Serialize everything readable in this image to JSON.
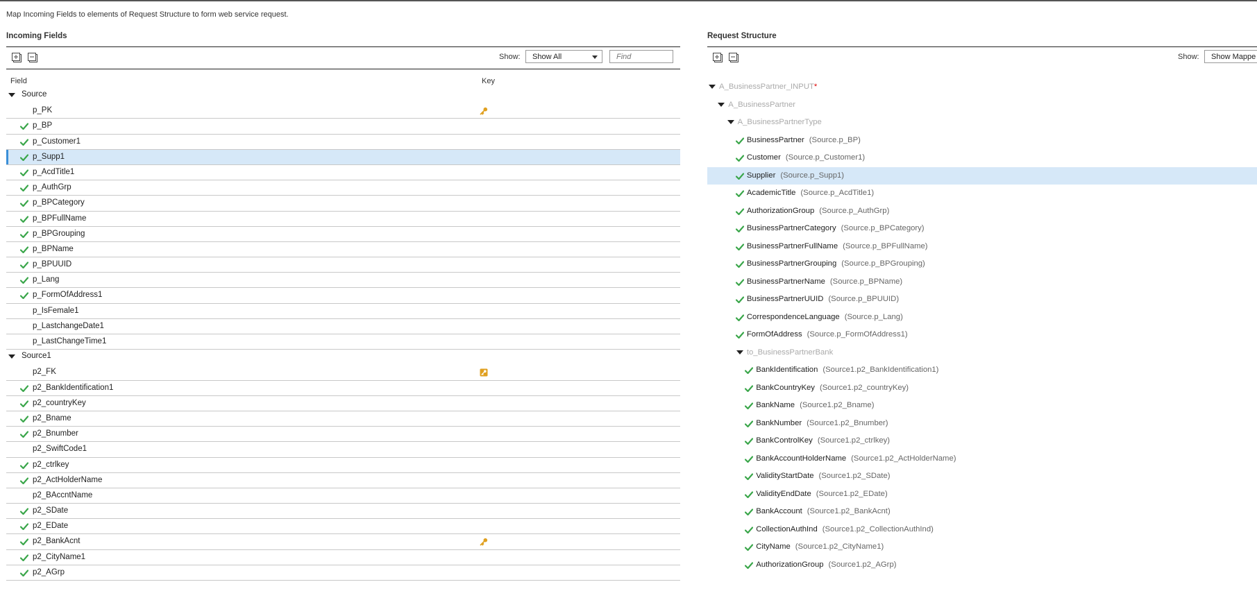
{
  "instruction": "Map Incoming Fields to elements of Request Structure to form web service request.",
  "incoming": {
    "title": "Incoming Fields",
    "show_label": "Show:",
    "show_value": "Show All",
    "find_placeholder": "Find",
    "col_field": "Field",
    "col_key": "Key",
    "rows": [
      {
        "name": "Source",
        "group": true
      },
      {
        "name": "p_PK",
        "mapped": false,
        "key": "key"
      },
      {
        "name": "p_BP",
        "mapped": true
      },
      {
        "name": "p_Customer1",
        "mapped": true
      },
      {
        "name": "p_Supp1",
        "mapped": true,
        "selected": true
      },
      {
        "name": "p_AcdTitle1",
        "mapped": true
      },
      {
        "name": "p_AuthGrp",
        "mapped": true
      },
      {
        "name": "p_BPCategory",
        "mapped": true
      },
      {
        "name": "p_BPFullName",
        "mapped": true
      },
      {
        "name": "p_BPGrouping",
        "mapped": true
      },
      {
        "name": "p_BPName",
        "mapped": true
      },
      {
        "name": "p_BPUUID",
        "mapped": true
      },
      {
        "name": "p_Lang",
        "mapped": true
      },
      {
        "name": "p_FormOfAddress1",
        "mapped": true
      },
      {
        "name": "p_IsFemale1",
        "mapped": false
      },
      {
        "name": "p_LastchangeDate1",
        "mapped": false
      },
      {
        "name": "p_LastChangeTime1",
        "mapped": false
      },
      {
        "name": "Source1",
        "group": true
      },
      {
        "name": "p2_FK",
        "mapped": false,
        "key": "foreign-key"
      },
      {
        "name": "p2_BankIdentification1",
        "mapped": true
      },
      {
        "name": "p2_countryKey",
        "mapped": true
      },
      {
        "name": "p2_Bname",
        "mapped": true
      },
      {
        "name": "p2_Bnumber",
        "mapped": true
      },
      {
        "name": "p2_SwiftCode1",
        "mapped": false
      },
      {
        "name": "p2_ctrlkey",
        "mapped": true
      },
      {
        "name": "p2_ActHolderName",
        "mapped": true
      },
      {
        "name": "p2_BAccntName",
        "mapped": false
      },
      {
        "name": "p2_SDate",
        "mapped": true
      },
      {
        "name": "p2_EDate",
        "mapped": true
      },
      {
        "name": "p2_BankAcnt",
        "mapped": true,
        "key": "key"
      },
      {
        "name": "p2_CityName1",
        "mapped": true
      },
      {
        "name": "p2_AGrp",
        "mapped": true
      }
    ]
  },
  "request": {
    "title": "Request Structure",
    "show_label": "Show:",
    "show_value": "Show Mappe",
    "nodes": [
      {
        "name": "A_BusinessPartner_INPUT",
        "level": 0,
        "expand": true,
        "dim": true,
        "required": "*"
      },
      {
        "name": "A_BusinessPartner",
        "level": 1,
        "expand": true,
        "dim": true
      },
      {
        "name": "A_BusinessPartnerType",
        "level": 2,
        "expand": true,
        "dim": true
      },
      {
        "name": "BusinessPartner",
        "level": 3,
        "mapped": true,
        "src": "(Source.p_BP)"
      },
      {
        "name": "Customer",
        "level": 3,
        "mapped": true,
        "src": "(Source.p_Customer1)"
      },
      {
        "name": "Supplier",
        "level": 3,
        "mapped": true,
        "src": "(Source.p_Supp1)",
        "selected": true
      },
      {
        "name": "AcademicTitle",
        "level": 3,
        "mapped": true,
        "src": "(Source.p_AcdTitle1)"
      },
      {
        "name": "AuthorizationGroup",
        "level": 3,
        "mapped": true,
        "src": "(Source.p_AuthGrp)"
      },
      {
        "name": "BusinessPartnerCategory",
        "level": 3,
        "mapped": true,
        "src": "(Source.p_BPCategory)"
      },
      {
        "name": "BusinessPartnerFullName",
        "level": 3,
        "mapped": true,
        "src": "(Source.p_BPFullName)"
      },
      {
        "name": "BusinessPartnerGrouping",
        "level": 3,
        "mapped": true,
        "src": "(Source.p_BPGrouping)"
      },
      {
        "name": "BusinessPartnerName",
        "level": 3,
        "mapped": true,
        "src": "(Source.p_BPName)"
      },
      {
        "name": "BusinessPartnerUUID",
        "level": 3,
        "mapped": true,
        "src": "(Source.p_BPUUID)"
      },
      {
        "name": "CorrespondenceLanguage",
        "level": 3,
        "mapped": true,
        "src": "(Source.p_Lang)"
      },
      {
        "name": "FormOfAddress",
        "level": 3,
        "mapped": true,
        "src": "(Source.p_FormOfAddress1)"
      },
      {
        "name": "to_BusinessPartnerBank",
        "level": 3,
        "expand": true,
        "dim": true
      },
      {
        "name": "BankIdentification",
        "level": 4,
        "mapped": true,
        "src": "(Source1.p2_BankIdentification1)"
      },
      {
        "name": "BankCountryKey",
        "level": 4,
        "mapped": true,
        "src": "(Source1.p2_countryKey)"
      },
      {
        "name": "BankName",
        "level": 4,
        "mapped": true,
        "src": "(Source1.p2_Bname)"
      },
      {
        "name": "BankNumber",
        "level": 4,
        "mapped": true,
        "src": "(Source1.p2_Bnumber)"
      },
      {
        "name": "BankControlKey",
        "level": 4,
        "mapped": true,
        "src": "(Source1.p2_ctrlkey)"
      },
      {
        "name": "BankAccountHolderName",
        "level": 4,
        "mapped": true,
        "src": "(Source1.p2_ActHolderName)"
      },
      {
        "name": "ValidityStartDate",
        "level": 4,
        "mapped": true,
        "src": "(Source1.p2_SDate)"
      },
      {
        "name": "ValidityEndDate",
        "level": 4,
        "mapped": true,
        "src": "(Source1.p2_EDate)"
      },
      {
        "name": "BankAccount",
        "level": 4,
        "mapped": true,
        "src": "(Source1.p2_BankAcnt)"
      },
      {
        "name": "CollectionAuthInd",
        "level": 4,
        "mapped": true,
        "src": "(Source1.p2_CollectionAuthInd)"
      },
      {
        "name": "CityName",
        "level": 4,
        "mapped": true,
        "src": "(Source1.p2_CityName1)"
      },
      {
        "name": "AuthorizationGroup",
        "level": 4,
        "mapped": true,
        "src": "(Source1.p2_AGrp)"
      }
    ]
  },
  "colors": {
    "check": "#3aa64a",
    "key": "#e0a020",
    "selected": "#d6e8f8",
    "accent": "#3a8fd8"
  },
  "icons": [
    "expand-all-icon",
    "collapse-all-icon",
    "checkmark-icon",
    "key-icon",
    "foreign-key-icon",
    "triangle-down-icon"
  ]
}
